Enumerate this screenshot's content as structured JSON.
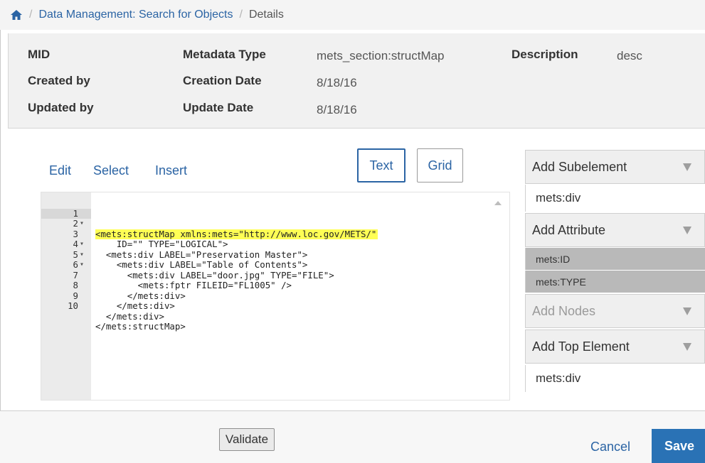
{
  "breadcrumb": {
    "home_icon": "home-icon",
    "separator": "/",
    "items": [
      {
        "label": "Data Management: Search for Objects"
      },
      {
        "label": "Details"
      }
    ]
  },
  "details": {
    "col1": [
      {
        "label": "MID",
        "value": ""
      },
      {
        "label": "Created by",
        "value": ""
      },
      {
        "label": "Updated by",
        "value": ""
      }
    ],
    "col2": [
      {
        "label": "Metadata Type",
        "value": "mets_section:structMap"
      },
      {
        "label": "Creation Date",
        "value": "8/18/16"
      },
      {
        "label": "Update Date",
        "value": "8/18/16"
      }
    ],
    "col3": [
      {
        "label": "Description",
        "value": "desc"
      }
    ]
  },
  "toolbar": {
    "menus": [
      "Edit",
      "Select",
      "Insert"
    ],
    "view_toggle": {
      "text": "Text",
      "grid": "Grid",
      "active": "Text"
    }
  },
  "editor": {
    "lines": [
      {
        "num": "1",
        "fold": "▾",
        "text": "<mets:structMap xmlns:mets=\"http://www.loc.gov/METS/\"",
        "highlight": true
      },
      {
        "num": "2",
        "fold": "",
        "text": "    ID=\"\" TYPE=\"LOGICAL\">"
      },
      {
        "num": "3",
        "fold": "▾",
        "text": "  <mets:div LABEL=\"Preservation Master\">"
      },
      {
        "num": "4",
        "fold": "▾",
        "text": "    <mets:div LABEL=\"Table of Contents\">"
      },
      {
        "num": "5",
        "fold": "▾",
        "text": "      <mets:div LABEL=\"door.jpg\" TYPE=\"FILE\">"
      },
      {
        "num": "6",
        "fold": "",
        "text": "        <mets:fptr FILEID=\"FL1005\" />"
      },
      {
        "num": "7",
        "fold": "",
        "text": "      </mets:div>"
      },
      {
        "num": "8",
        "fold": "",
        "text": "    </mets:div>"
      },
      {
        "num": "9",
        "fold": "",
        "text": "  </mets:div>"
      },
      {
        "num": "10",
        "fold": "",
        "text": "</mets:structMap>"
      }
    ]
  },
  "right_panel": {
    "add_subelement": {
      "label": "Add Subelement",
      "items": [
        "mets:div"
      ]
    },
    "add_attribute": {
      "label": "Add Attribute",
      "items": [
        "mets:ID",
        "mets:TYPE"
      ]
    },
    "add_nodes": {
      "label": "Add Nodes"
    },
    "add_top_element": {
      "label": "Add Top Element",
      "items": [
        "mets:div"
      ]
    }
  },
  "footer": {
    "validate_label": "Validate",
    "cancel_label": "Cancel",
    "save_label": "Save"
  },
  "colors": {
    "link": "#2b64a4",
    "save_bg": "#2a72b5",
    "highlight": "#ffff55"
  }
}
